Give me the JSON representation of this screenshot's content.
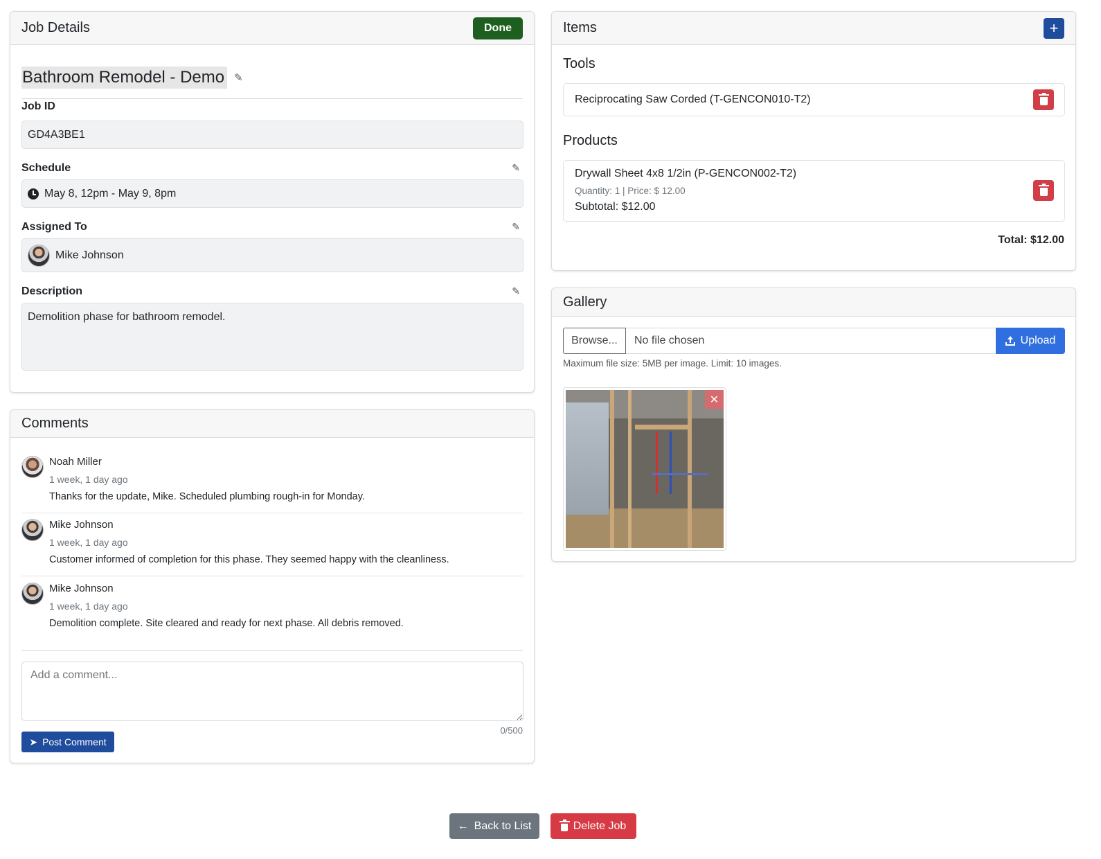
{
  "job_details": {
    "header": "Job Details",
    "done_label": "Done",
    "title": "Bathroom Remodel - Demo",
    "job_id_label": "Job ID",
    "job_id": "GD4A3BE1",
    "schedule_label": "Schedule",
    "schedule": "May 8, 12pm - May 9, 8pm",
    "assigned_label": "Assigned To",
    "assigned_to": "Mike Johnson",
    "description_label": "Description",
    "description": "Demolition phase for bathroom remodel."
  },
  "comments": {
    "header": "Comments",
    "items": [
      {
        "name": "Noah Miller",
        "time": "1 week, 1 day ago",
        "text": "Thanks for the update, Mike. Scheduled plumbing rough-in for Monday."
      },
      {
        "name": "Mike Johnson",
        "time": "1 week, 1 day ago",
        "text": "Customer informed of completion for this phase. They seemed happy with the cleanliness."
      },
      {
        "name": "Mike Johnson",
        "time": "1 week, 1 day ago",
        "text": "Demolition complete. Site cleared and ready for next phase. All debris removed."
      }
    ],
    "input_placeholder": "Add a comment...",
    "char_count": "0/500",
    "post_label": "Post Comment"
  },
  "items": {
    "header": "Items",
    "add_label": "+",
    "tools_title": "Tools",
    "tools": [
      {
        "name": "Reciprocating Saw Corded (T-GENCON010-T2)"
      }
    ],
    "products_title": "Products",
    "products": [
      {
        "name": "Drywall Sheet 4x8 1/2in (P-GENCON002-T2)",
        "meta": "Quantity: 1 | Price: $ 12.00",
        "subtotal": "Subtotal: $12.00"
      }
    ],
    "total": "Total: $12.00"
  },
  "gallery": {
    "header": "Gallery",
    "browse_label": "Browse...",
    "no_file_label": "No file chosen",
    "upload_label": "Upload",
    "hint": "Maximum file size: 5MB per image. Limit: 10 images.",
    "close_label": "✕"
  },
  "footer": {
    "back_label": "Back to List",
    "back_icon": "←",
    "delete_label": "Delete Job"
  },
  "colors": {
    "done": "#1e5e1e",
    "primary": "#1f4c9c",
    "upload": "#2f6fe0",
    "danger": "#d63b45",
    "secondary": "#6c757d"
  }
}
